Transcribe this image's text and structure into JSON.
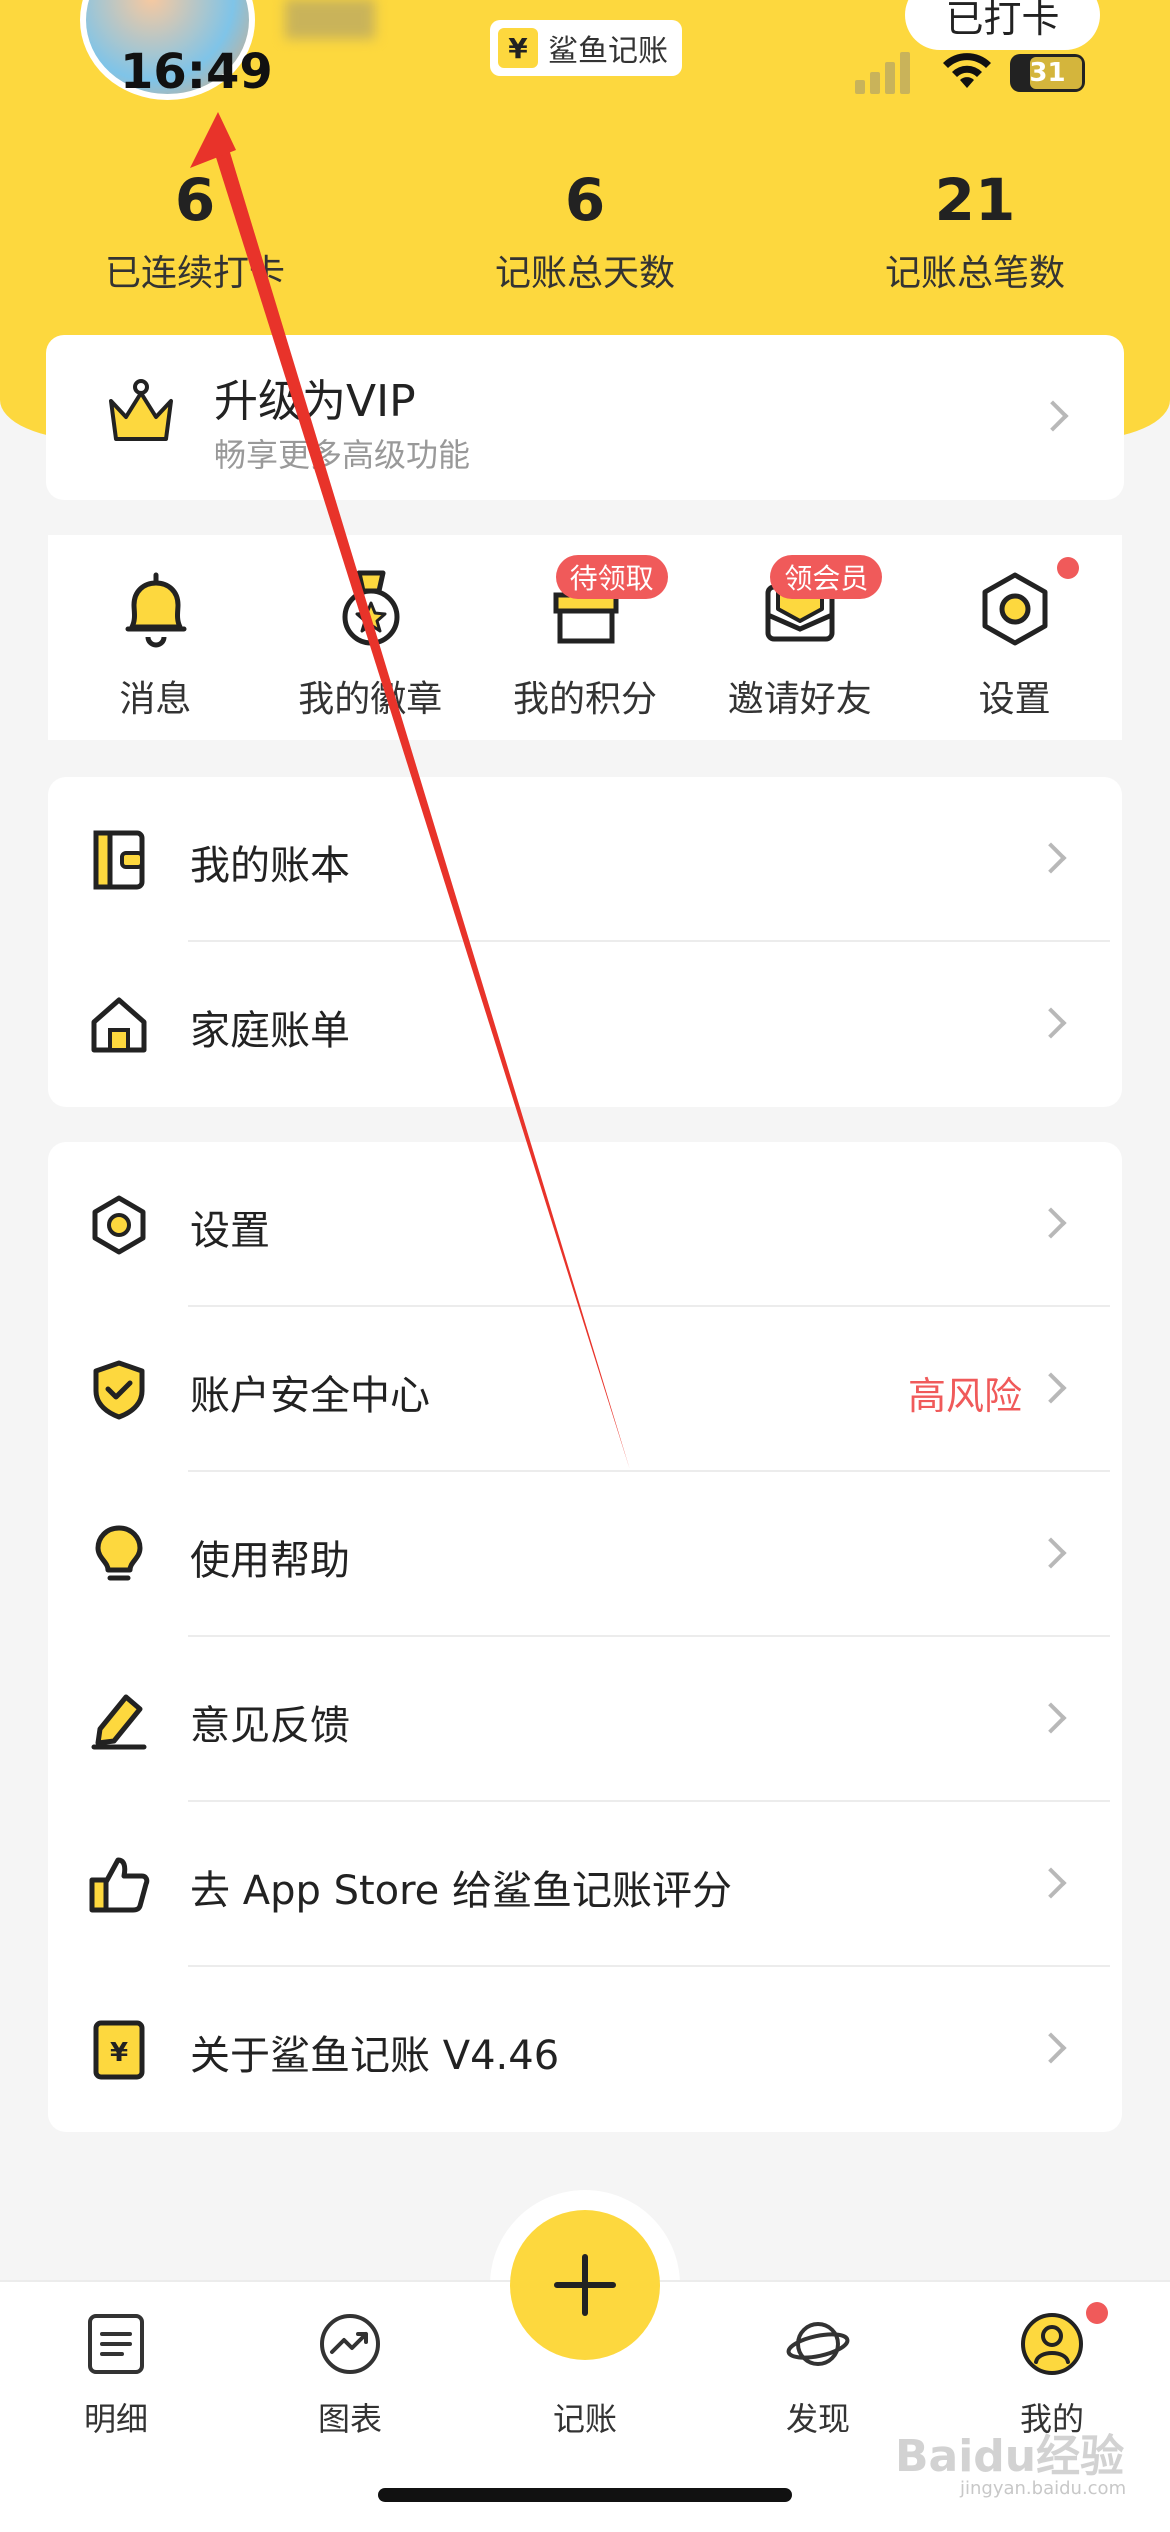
{
  "status_bar": {
    "time": "16:49",
    "battery": "31"
  },
  "profile": {
    "name_visible": ""
  },
  "app_badge": {
    "icon": "¥",
    "label": "鲨鱼记账"
  },
  "checkin_button": "已打卡",
  "stats": [
    {
      "value": "6",
      "label": "已连续打卡"
    },
    {
      "value": "6",
      "label": "记账总天数"
    },
    {
      "value": "21",
      "label": "记账总笔数"
    }
  ],
  "vip": {
    "title": "升级为VIP",
    "subtitle": "畅享更多高级功能"
  },
  "quick_actions": [
    {
      "label": "消息",
      "icon": "bell-icon"
    },
    {
      "label": "我的徽章",
      "icon": "medal-icon"
    },
    {
      "label": "我的积分",
      "icon": "gift-icon",
      "badge": "待领取"
    },
    {
      "label": "邀请好友",
      "icon": "envelope-icon",
      "badge": "领会员"
    },
    {
      "label": "设置",
      "icon": "settings-icon"
    }
  ],
  "menu_group_1": [
    {
      "label": "我的账本",
      "icon": "book-icon"
    },
    {
      "label": "家庭账单",
      "icon": "house-icon"
    }
  ],
  "menu_group_2": [
    {
      "label": "设置",
      "icon": "settings-icon"
    },
    {
      "label": "账户安全中心",
      "icon": "shield-icon",
      "right_text": "高风险"
    },
    {
      "label": "使用帮助",
      "icon": "lightbulb-icon"
    },
    {
      "label": "意见反馈",
      "icon": "edit-icon"
    },
    {
      "label": "去 App Store 给鲨鱼记账评分",
      "icon": "thumbs-up-icon"
    },
    {
      "label": "关于鲨鱼记账 V4.46",
      "icon": "yen-icon"
    }
  ],
  "tabbar": [
    {
      "label": "明细",
      "icon": "list-icon"
    },
    {
      "label": "图表",
      "icon": "chart-icon"
    },
    {
      "label": "记账",
      "icon": "add-icon"
    },
    {
      "label": "发现",
      "icon": "planet-icon"
    },
    {
      "label": "我的",
      "icon": "user-icon"
    }
  ],
  "watermark": {
    "text": "Baidu经验",
    "sub": "jingyan.baidu.com"
  },
  "colors": {
    "brand_yellow": "#fdd83e",
    "alert_red": "#f05a5a"
  }
}
